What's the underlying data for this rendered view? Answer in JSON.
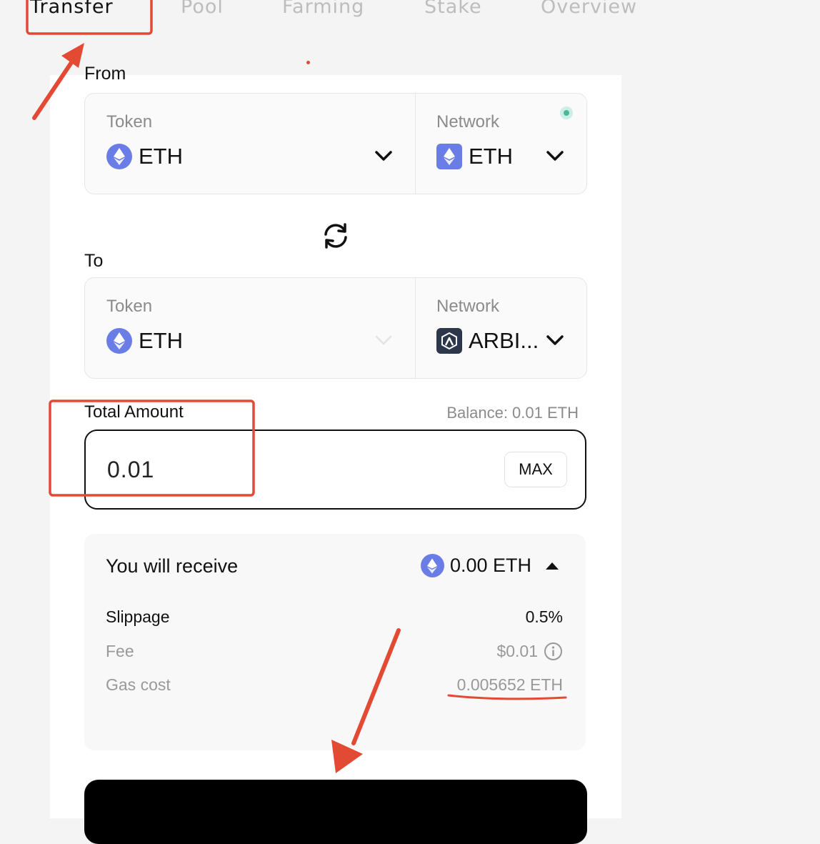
{
  "tabs": [
    {
      "label": "Transfer",
      "active": true
    },
    {
      "label": "Pool",
      "active": false
    },
    {
      "label": "Farming",
      "active": false
    },
    {
      "label": "Stake",
      "active": false
    },
    {
      "label": "Overview",
      "active": false
    }
  ],
  "from": {
    "label": "From",
    "token_caption": "Token",
    "token_value": "ETH",
    "network_caption": "Network",
    "network_value": "ETH"
  },
  "to": {
    "label": "To",
    "token_caption": "Token",
    "token_value": "ETH",
    "network_caption": "Network",
    "network_value": "ARBI..."
  },
  "amount": {
    "label": "Total Amount",
    "balance": "Balance: 0.01 ETH",
    "value": "0.01",
    "max_label": "MAX"
  },
  "receive": {
    "title": "You will receive",
    "amount": "0.00 ETH",
    "slippage_label": "Slippage",
    "slippage_value": "0.5%",
    "fee_label": "Fee",
    "fee_value": "$0.01",
    "gas_label": "Gas cost",
    "gas_value": "0.005652 ETH"
  },
  "colors": {
    "accent_annotation": "#e34a33",
    "coin": "#6a7de6",
    "arbitrum": "#2d374b"
  },
  "icons": [
    "eth-icon",
    "arbitrum-icon",
    "chevron-down-icon",
    "swap-icon",
    "chevron-up-icon",
    "info-icon"
  ]
}
